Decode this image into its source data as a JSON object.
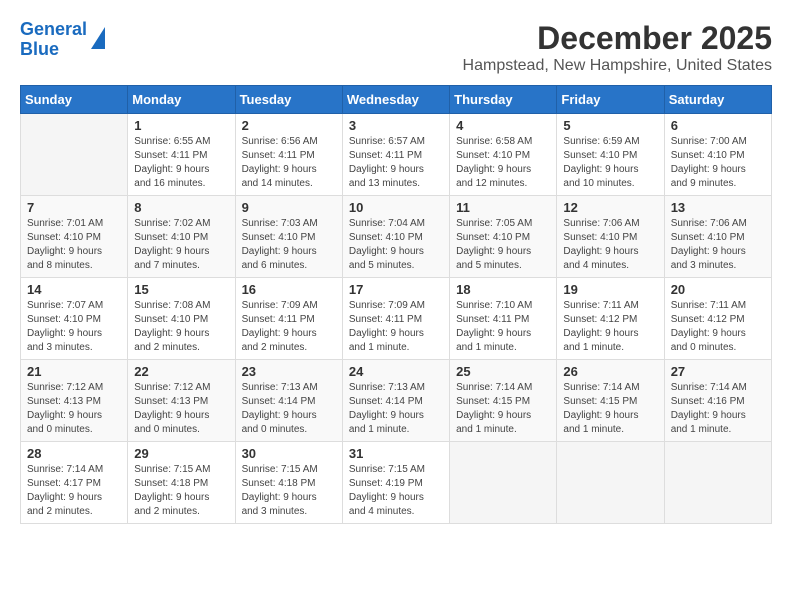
{
  "logo": {
    "line1": "General",
    "line2": "Blue"
  },
  "title": {
    "month": "December 2025",
    "location": "Hampstead, New Hampshire, United States"
  },
  "days_of_week": [
    "Sunday",
    "Monday",
    "Tuesday",
    "Wednesday",
    "Thursday",
    "Friday",
    "Saturday"
  ],
  "weeks": [
    [
      {
        "day": "",
        "info": ""
      },
      {
        "day": "1",
        "info": "Sunrise: 6:55 AM\nSunset: 4:11 PM\nDaylight: 9 hours\nand 16 minutes."
      },
      {
        "day": "2",
        "info": "Sunrise: 6:56 AM\nSunset: 4:11 PM\nDaylight: 9 hours\nand 14 minutes."
      },
      {
        "day": "3",
        "info": "Sunrise: 6:57 AM\nSunset: 4:11 PM\nDaylight: 9 hours\nand 13 minutes."
      },
      {
        "day": "4",
        "info": "Sunrise: 6:58 AM\nSunset: 4:10 PM\nDaylight: 9 hours\nand 12 minutes."
      },
      {
        "day": "5",
        "info": "Sunrise: 6:59 AM\nSunset: 4:10 PM\nDaylight: 9 hours\nand 10 minutes."
      },
      {
        "day": "6",
        "info": "Sunrise: 7:00 AM\nSunset: 4:10 PM\nDaylight: 9 hours\nand 9 minutes."
      }
    ],
    [
      {
        "day": "7",
        "info": "Sunrise: 7:01 AM\nSunset: 4:10 PM\nDaylight: 9 hours\nand 8 minutes."
      },
      {
        "day": "8",
        "info": "Sunrise: 7:02 AM\nSunset: 4:10 PM\nDaylight: 9 hours\nand 7 minutes."
      },
      {
        "day": "9",
        "info": "Sunrise: 7:03 AM\nSunset: 4:10 PM\nDaylight: 9 hours\nand 6 minutes."
      },
      {
        "day": "10",
        "info": "Sunrise: 7:04 AM\nSunset: 4:10 PM\nDaylight: 9 hours\nand 5 minutes."
      },
      {
        "day": "11",
        "info": "Sunrise: 7:05 AM\nSunset: 4:10 PM\nDaylight: 9 hours\nand 5 minutes."
      },
      {
        "day": "12",
        "info": "Sunrise: 7:06 AM\nSunset: 4:10 PM\nDaylight: 9 hours\nand 4 minutes."
      },
      {
        "day": "13",
        "info": "Sunrise: 7:06 AM\nSunset: 4:10 PM\nDaylight: 9 hours\nand 3 minutes."
      }
    ],
    [
      {
        "day": "14",
        "info": "Sunrise: 7:07 AM\nSunset: 4:10 PM\nDaylight: 9 hours\nand 3 minutes."
      },
      {
        "day": "15",
        "info": "Sunrise: 7:08 AM\nSunset: 4:10 PM\nDaylight: 9 hours\nand 2 minutes."
      },
      {
        "day": "16",
        "info": "Sunrise: 7:09 AM\nSunset: 4:11 PM\nDaylight: 9 hours\nand 2 minutes."
      },
      {
        "day": "17",
        "info": "Sunrise: 7:09 AM\nSunset: 4:11 PM\nDaylight: 9 hours\nand 1 minute."
      },
      {
        "day": "18",
        "info": "Sunrise: 7:10 AM\nSunset: 4:11 PM\nDaylight: 9 hours\nand 1 minute."
      },
      {
        "day": "19",
        "info": "Sunrise: 7:11 AM\nSunset: 4:12 PM\nDaylight: 9 hours\nand 1 minute."
      },
      {
        "day": "20",
        "info": "Sunrise: 7:11 AM\nSunset: 4:12 PM\nDaylight: 9 hours\nand 0 minutes."
      }
    ],
    [
      {
        "day": "21",
        "info": "Sunrise: 7:12 AM\nSunset: 4:13 PM\nDaylight: 9 hours\nand 0 minutes."
      },
      {
        "day": "22",
        "info": "Sunrise: 7:12 AM\nSunset: 4:13 PM\nDaylight: 9 hours\nand 0 minutes."
      },
      {
        "day": "23",
        "info": "Sunrise: 7:13 AM\nSunset: 4:14 PM\nDaylight: 9 hours\nand 0 minutes."
      },
      {
        "day": "24",
        "info": "Sunrise: 7:13 AM\nSunset: 4:14 PM\nDaylight: 9 hours\nand 1 minute."
      },
      {
        "day": "25",
        "info": "Sunrise: 7:14 AM\nSunset: 4:15 PM\nDaylight: 9 hours\nand 1 minute."
      },
      {
        "day": "26",
        "info": "Sunrise: 7:14 AM\nSunset: 4:15 PM\nDaylight: 9 hours\nand 1 minute."
      },
      {
        "day": "27",
        "info": "Sunrise: 7:14 AM\nSunset: 4:16 PM\nDaylight: 9 hours\nand 1 minute."
      }
    ],
    [
      {
        "day": "28",
        "info": "Sunrise: 7:14 AM\nSunset: 4:17 PM\nDaylight: 9 hours\nand 2 minutes."
      },
      {
        "day": "29",
        "info": "Sunrise: 7:15 AM\nSunset: 4:18 PM\nDaylight: 9 hours\nand 2 minutes."
      },
      {
        "day": "30",
        "info": "Sunrise: 7:15 AM\nSunset: 4:18 PM\nDaylight: 9 hours\nand 3 minutes."
      },
      {
        "day": "31",
        "info": "Sunrise: 7:15 AM\nSunset: 4:19 PM\nDaylight: 9 hours\nand 4 minutes."
      },
      {
        "day": "",
        "info": ""
      },
      {
        "day": "",
        "info": ""
      },
      {
        "day": "",
        "info": ""
      }
    ]
  ]
}
